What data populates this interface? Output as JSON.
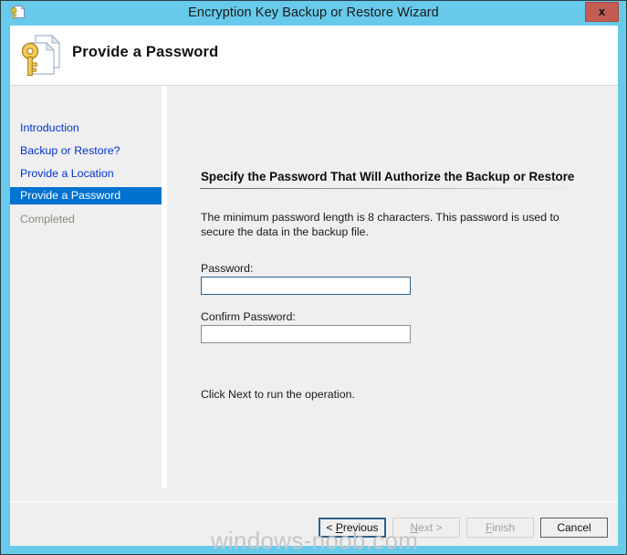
{
  "window": {
    "title": "Encryption Key Backup or Restore Wizard",
    "titlebar_icon": "key-document-icon",
    "close_label": "x",
    "accent_color": "#67caea",
    "close_button_color": "#c35d53"
  },
  "banner": {
    "icon": "key-document-icon",
    "title": "Provide a Password"
  },
  "sidebar": {
    "selected_color": "#0072d0",
    "link_color": "#0033cc",
    "disabled_color": "#8a8a7e",
    "items": [
      {
        "label": "Introduction",
        "state": "link"
      },
      {
        "label": "Backup or Restore?",
        "state": "link"
      },
      {
        "label": "Provide a Location",
        "state": "link"
      },
      {
        "label": "Provide a Password",
        "state": "selected"
      },
      {
        "label": "Completed",
        "state": "disabled"
      }
    ]
  },
  "pane": {
    "heading": "Specify the Password That Will Authorize the Backup or Restore",
    "description": "The minimum password length is 8 characters.  This password is used to secure the data in the backup file.",
    "password_label": "Password:",
    "password_value": "",
    "password_placeholder": "",
    "confirm_label": "Confirm Password:",
    "confirm_value": "",
    "confirm_placeholder": "",
    "hint": "Click Next to run the operation."
  },
  "footer": {
    "buttons": [
      {
        "name": "previous",
        "prefix": "< ",
        "accel": "P",
        "rest": "revious",
        "suffix": "",
        "state": "focused"
      },
      {
        "name": "next",
        "prefix": "",
        "accel": "N",
        "rest": "ext",
        "suffix": " >",
        "state": "disabled"
      },
      {
        "name": "finish",
        "prefix": "",
        "accel": "F",
        "rest": "inish",
        "suffix": "",
        "state": "disabled"
      },
      {
        "name": "cancel",
        "prefix": "",
        "accel": "",
        "rest": "Cancel",
        "suffix": "",
        "state": "default"
      }
    ]
  },
  "watermark": {
    "text": "windows-noob.com"
  }
}
